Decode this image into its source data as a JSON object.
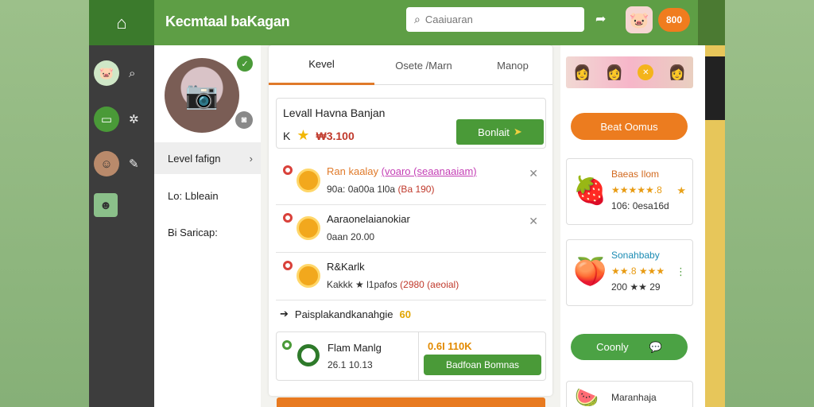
{
  "app": {
    "title": "Kecmtaal baKagan"
  },
  "header": {
    "search_placeholder": "Caaiuaran",
    "coins": "800",
    "home_icon": "home-icon",
    "search_icon": "search-icon",
    "share_icon": "share-icon"
  },
  "rail": {
    "items": [
      {
        "icon": "pig-avatar",
        "action_icon": "search-icon"
      },
      {
        "icon": "chat-icon",
        "action_icon": "settings-icon"
      },
      {
        "icon": "user-avatar",
        "action_icon": "edit-icon"
      },
      {
        "icon": "photo-avatar",
        "action_icon": ""
      }
    ]
  },
  "profile": {
    "menu": [
      {
        "label": "Level fafign",
        "active": true
      },
      {
        "label": "Lo: Lbleain",
        "active": false
      },
      {
        "label": "Bi Saricap:",
        "active": false
      }
    ]
  },
  "main": {
    "tabs": [
      {
        "label": "Kevel",
        "active": true
      },
      {
        "label": "Osete /Marn",
        "active": false
      },
      {
        "label": "Manop",
        "active": false
      }
    ],
    "level_box": {
      "title": "Levall Havna Banjan",
      "prefix": "K",
      "price": "₩3.100",
      "button_label": "Bonlait"
    },
    "items": [
      {
        "title_main": "Ran kaalay",
        "title_link": "(voaro (seaanaaiam)",
        "detail_main": "90a: 0a00a 1l0a",
        "detail_red": "(Ba 190)",
        "closable": true
      },
      {
        "title_main": "Aaraonelaianokiar",
        "title_link": "",
        "detail_main": "0aan 20.00",
        "detail_red": "",
        "closable": true
      },
      {
        "title_main": "R&Karlk",
        "title_link": "",
        "detail_main": "Kakkk ★ l1pafos",
        "detail_red": "(2980 (aeoial)",
        "closable": false
      }
    ],
    "promo": {
      "label": "Paisplakandkanahgie",
      "badge": "60"
    },
    "bottom": {
      "title": "Flam Manlg",
      "sub": "26.1 10.13",
      "amount": "0.6I 110K",
      "button_label": "Badfoan Bomnas"
    },
    "colors": {
      "accent_orange": "#e87a20",
      "accent_green": "#4a9a38",
      "header_green": "#5e9e45"
    }
  },
  "sidebar": {
    "button_label": "Beat Oomus",
    "products": [
      {
        "name": "Baeas Ilom",
        "rating": "★★★★★.8",
        "price": "106: 0esa16d",
        "fruit_icon": "raspberry-icon",
        "name_color": "#d2691e"
      },
      {
        "name": "Sonahbaby",
        "rating": "★★.8 ★★★",
        "price": "200 ★★ 29",
        "fruit_icon": "peach-icon",
        "name_color": "#1a8bb3"
      }
    ],
    "green_button_label": "Coonly",
    "mini_product": {
      "name": "Maranhaja"
    }
  }
}
